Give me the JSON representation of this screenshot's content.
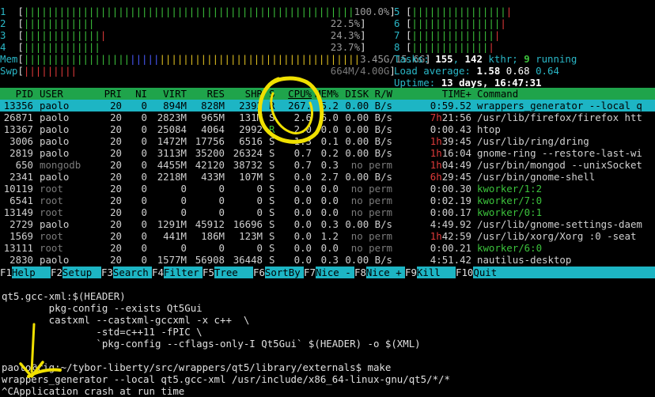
{
  "meters": {
    "cpu": [
      {
        "label": "1",
        "bar": "||||||||||||||||||||||||||||||||||||||||||||||||||||||||",
        "pct": "100.0%",
        "level": 1.0
      },
      {
        "label": "2",
        "bar": "||||||||||||",
        "pct": "22.5%",
        "level": 0.225
      },
      {
        "label": "3",
        "bar": "|||||||||||||",
        "pct": "24.3%",
        "level": 0.243
      },
      {
        "label": "4",
        "bar": "|||||||||||||",
        "pct": "23.7%",
        "level": 0.237
      }
    ],
    "cpu_right": [
      {
        "label": "5",
        "bar": "||||||||||||||||"
      },
      {
        "label": "6",
        "bar": "|||||||||||||||"
      },
      {
        "label": "7",
        "bar": "||||||||||||||"
      },
      {
        "label": "8",
        "bar": "|||||||||||||"
      }
    ],
    "mem": {
      "label": "Mem",
      "value": "3.45G/15.6G"
    },
    "swp": {
      "label": "Swp",
      "value": "664M/4.00G"
    },
    "tasks": {
      "label": "Tasks:",
      "count": "155",
      "kthr": "142",
      "kthr_label": "kthr;",
      "running": "9",
      "running_label": "running"
    },
    "load": {
      "label": "Load average:",
      "v1": "1.58",
      "v2": "0.68",
      "v3": "0.64"
    },
    "uptime": {
      "label": "Uptime:",
      "value": "13 days, 16:47:31"
    }
  },
  "table": {
    "headers": [
      "PID",
      "USER",
      "PRI",
      "NI",
      "VIRT",
      "RES",
      "SHR",
      "S",
      "CPU%",
      "MEM%",
      "DISK R/W",
      "TIME+",
      "Command"
    ],
    "rows": [
      {
        "pid": "13356",
        "user": "paolo",
        "pri": "20",
        "ni": "0",
        "virt": "894M",
        "res": "828M",
        "shr": "2392",
        "s": "R",
        "cpu": "267.",
        "mem": "5.2",
        "disk": "0.00 B/s",
        "time": "0:59.52",
        "cmd": "wrappers_generator --local q",
        "sel": true
      },
      {
        "pid": "26871",
        "user": "paolo",
        "pri": "20",
        "ni": "0",
        "virt": "2823M",
        "res": "965M",
        "shr": "131M",
        "s": "S",
        "cpu": "2.6",
        "mem": "6.0",
        "disk": "0.00 B/s",
        "time": "7h21:56",
        "cmd": "/usr/lib/firefox/firefox htt"
      },
      {
        "pid": "13367",
        "user": "paolo",
        "pri": "20",
        "ni": "0",
        "virt": "25084",
        "res": "4064",
        "shr": "2992",
        "s": "R",
        "cpu": "2.0",
        "mem": "0.0",
        "disk": "0.00 B/s",
        "time": "0:00.43",
        "cmd": "htop"
      },
      {
        "pid": "3006",
        "user": "paolo",
        "pri": "20",
        "ni": "0",
        "virt": "1472M",
        "res": "17756",
        "shr": "6516",
        "s": "S",
        "cpu": "1.3",
        "mem": "0.1",
        "disk": "0.00 B/s",
        "time": "1h39:45",
        "cmd": "/usr/lib/ring/dring"
      },
      {
        "pid": "2819",
        "user": "paolo",
        "pri": "20",
        "ni": "0",
        "virt": "3113M",
        "res": "35200",
        "shr": "26324",
        "s": "S",
        "cpu": "0.7",
        "mem": "0.2",
        "disk": "0.00 B/s",
        "time": "1h16:04",
        "cmd": "gnome-ring --restore-last-wi"
      },
      {
        "pid": "650",
        "user": "mongodb",
        "pri": "20",
        "ni": "0",
        "virt": "4455M",
        "res": "42120",
        "shr": "38732",
        "s": "S",
        "cpu": "0.7",
        "mem": "0.3",
        "disk": "no perm",
        "time": "1h04:49",
        "cmd": "/usr/bin/mongod --unixSocket"
      },
      {
        "pid": "2341",
        "user": "paolo",
        "pri": "20",
        "ni": "0",
        "virt": "2218M",
        "res": "433M",
        "shr": "107M",
        "s": "S",
        "cpu": "0.0",
        "mem": "2.7",
        "disk": "0.00 B/s",
        "time": "6h29:45",
        "cmd": "/usr/bin/gnome-shell"
      },
      {
        "pid": "10119",
        "user": "root",
        "pri": "20",
        "ni": "0",
        "virt": "0",
        "res": "0",
        "shr": "0",
        "s": "S",
        "cpu": "0.0",
        "mem": "0.0",
        "disk": "no perm",
        "time": "0:00.30",
        "cmd": "kworker/1:2"
      },
      {
        "pid": "6541",
        "user": "root",
        "pri": "20",
        "ni": "0",
        "virt": "0",
        "res": "0",
        "shr": "0",
        "s": "S",
        "cpu": "0.0",
        "mem": "0.0",
        "disk": "no perm",
        "time": "0:02.19",
        "cmd": "kworker/7:0"
      },
      {
        "pid": "13149",
        "user": "root",
        "pri": "20",
        "ni": "0",
        "virt": "0",
        "res": "0",
        "shr": "0",
        "s": "S",
        "cpu": "0.0",
        "mem": "0.0",
        "disk": "no perm",
        "time": "0:00.17",
        "cmd": "kworker/0:1"
      },
      {
        "pid": "2729",
        "user": "paolo",
        "pri": "20",
        "ni": "0",
        "virt": "1291M",
        "res": "45912",
        "shr": "16696",
        "s": "S",
        "cpu": "0.0",
        "mem": "0.3",
        "disk": "0.00 B/s",
        "time": "4:49.92",
        "cmd": "/usr/lib/gnome-settings-daem"
      },
      {
        "pid": "1569",
        "user": "root",
        "pri": "20",
        "ni": "0",
        "virt": "441M",
        "res": "186M",
        "shr": "123M",
        "s": "S",
        "cpu": "0.0",
        "mem": "1.2",
        "disk": "no perm",
        "time": "1h42:59",
        "cmd": "/usr/lib/xorg/Xorg :0 -seat"
      },
      {
        "pid": "13111",
        "user": "root",
        "pri": "20",
        "ni": "0",
        "virt": "0",
        "res": "0",
        "shr": "0",
        "s": "S",
        "cpu": "0.0",
        "mem": "0.0",
        "disk": "no perm",
        "time": "0:00.21",
        "cmd": "kworker/6:0"
      },
      {
        "pid": "2830",
        "user": "paolo",
        "pri": "20",
        "ni": "0",
        "virt": "1577M",
        "res": "56908",
        "shr": "36448",
        "s": "S",
        "cpu": "0.0",
        "mem": "0.3",
        "disk": "0.00 B/s",
        "time": "4:51.42",
        "cmd": "nautilus-desktop"
      }
    ]
  },
  "fkeys": [
    {
      "key": "F1",
      "label": "Help"
    },
    {
      "key": "F2",
      "label": "Setup"
    },
    {
      "key": "F3",
      "label": "Search"
    },
    {
      "key": "F4",
      "label": "Filter"
    },
    {
      "key": "F5",
      "label": "Tree"
    },
    {
      "key": "F6",
      "label": "SortBy"
    },
    {
      "key": "F7",
      "label": "Nice -"
    },
    {
      "key": "F8",
      "label": "Nice +"
    },
    {
      "key": "F9",
      "label": "Kill"
    },
    {
      "key": "F10",
      "label": "Quit"
    }
  ],
  "shell": {
    "lines": [
      "qt5.gcc-xml:$(HEADER)",
      "        pkg-config --exists Qt5Gui",
      "        castxml --castxml-gccxml -x c++  \\",
      "                -std=c++11 -fPIC \\",
      "                `pkg-config --cflags-only-I Qt5Gui` $(HEADER) -o $(XML)",
      "",
      "paolo@rig:~/tybor-liberty/src/wrappers/qt5/library/externals$ make",
      "wrappers_generator --local qt5.gcc-xml /usr/include/x86_64-linux-gnu/qt5/*/*",
      "^CApplication crash at run time"
    ]
  },
  "colors": {
    "header_bg": "#1fa44b",
    "selected_bg": "#1db5c4",
    "annotation": "#f0e000"
  }
}
